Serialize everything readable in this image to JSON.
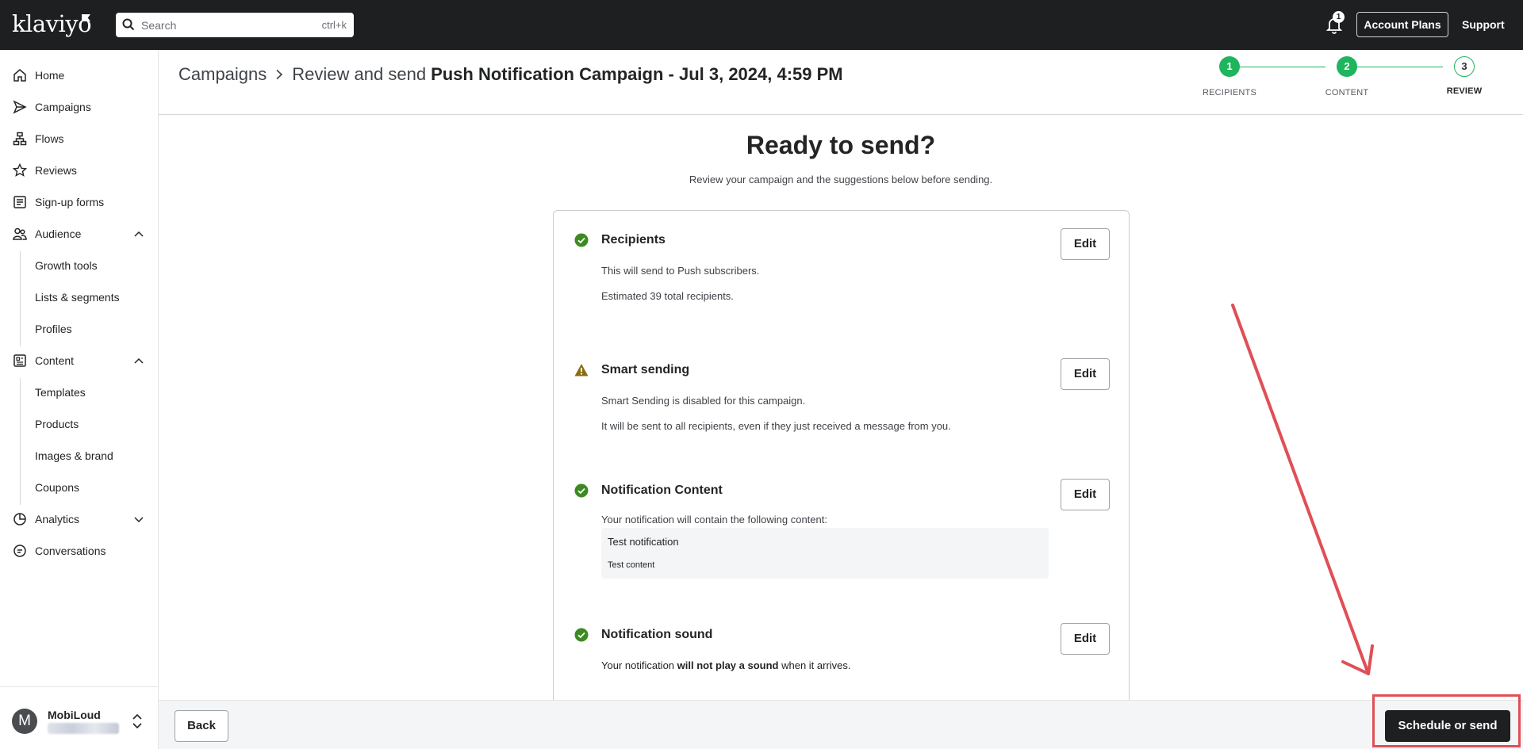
{
  "topbar": {
    "logo": "klaviyo",
    "search_placeholder": "Search",
    "search_shortcut": "ctrl+k",
    "notification_count": "1",
    "account_plans": "Account Plans",
    "support": "Support"
  },
  "sidebar": {
    "items": [
      {
        "label": "Home"
      },
      {
        "label": "Campaigns"
      },
      {
        "label": "Flows"
      },
      {
        "label": "Reviews"
      },
      {
        "label": "Sign-up forms"
      },
      {
        "label": "Audience"
      },
      {
        "label": "Content"
      },
      {
        "label": "Analytics"
      },
      {
        "label": "Conversations"
      }
    ],
    "audience_sub": [
      {
        "label": "Growth tools"
      },
      {
        "label": "Lists & segments"
      },
      {
        "label": "Profiles"
      }
    ],
    "content_sub": [
      {
        "label": "Templates"
      },
      {
        "label": "Products"
      },
      {
        "label": "Images & brand"
      },
      {
        "label": "Coupons"
      }
    ],
    "account": {
      "initial": "M",
      "name": "MobiLoud"
    }
  },
  "header": {
    "crumb_root": "Campaigns",
    "crumb_current": "Review and send",
    "campaign_name": "Push Notification Campaign - Jul 3, 2024, 4:59 PM",
    "steps": [
      {
        "number": "1",
        "label": "RECIPIENTS",
        "state": "done"
      },
      {
        "number": "2",
        "label": "CONTENT",
        "state": "done"
      },
      {
        "number": "3",
        "label": "REVIEW",
        "state": "current"
      }
    ]
  },
  "main": {
    "title": "Ready to send?",
    "subtitle": "Review your campaign and the suggestions below before sending.",
    "sections": [
      {
        "title": "Recipients",
        "status": "ok",
        "lines": [
          "This will send to Push subscribers.",
          "Estimated 39 total recipients."
        ],
        "edit": "Edit"
      },
      {
        "title": "Smart sending",
        "status": "warning",
        "lines": [
          "Smart Sending is disabled for this campaign.",
          "It will be sent to all recipients, even if they just received a message from you."
        ],
        "edit": "Edit"
      },
      {
        "title": "Notification Content",
        "status": "ok",
        "lines": [
          "Your notification will contain the following content:"
        ],
        "preview_title": "Test notification",
        "preview_body": "Test content",
        "edit": "Edit"
      },
      {
        "title": "Notification sound",
        "status": "ok",
        "line_pre": "Your notification ",
        "line_bold": "will not play a sound",
        "line_post": " when it arrives.",
        "edit": "Edit"
      }
    ]
  },
  "footer": {
    "back": "Back",
    "schedule": "Schedule or send"
  },
  "colors": {
    "topbar": "#1e1f21",
    "success": "#1fb45e",
    "check": "#3d8a22",
    "warning": "#8a6d12",
    "annotation": "#e04f55"
  }
}
